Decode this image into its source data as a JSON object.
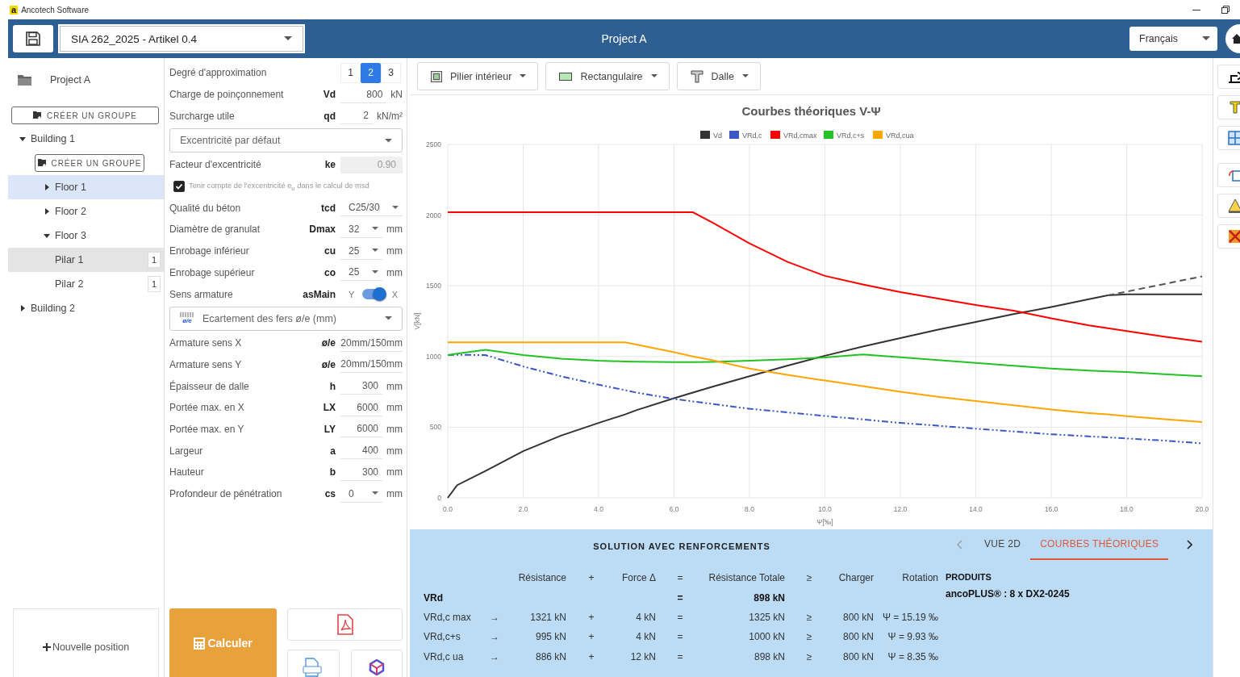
{
  "app": {
    "logo_text": "a",
    "title": "Ancotech Software"
  },
  "header": {
    "standard": "SIA 262_2025 - Artikel 0.4",
    "title": "Project A",
    "language": "Français"
  },
  "sidebar": {
    "project": "Project A",
    "group_button": "CRÉER UN GROUPE",
    "tree": [
      {
        "label": "Building 1",
        "expanded": true,
        "selected": false,
        "active": false,
        "group_button": "CRÉER UN GROUPE",
        "children": [
          {
            "label": "Floor 1",
            "expanded": false,
            "selected": true,
            "active": false
          },
          {
            "label": "Floor 2",
            "expanded": false,
            "selected": false,
            "active": false
          },
          {
            "label": "Floor 3",
            "expanded": true,
            "selected": false,
            "active": false,
            "children": [
              {
                "label": "Pilar 1",
                "badge": "1",
                "selected": false,
                "active": true
              },
              {
                "label": "Pilar 2",
                "badge": "1",
                "selected": false,
                "active": false
              }
            ]
          }
        ]
      },
      {
        "label": "Building 2",
        "expanded": false,
        "selected": false,
        "active": false
      }
    ],
    "new_button": "Nouvelle position"
  },
  "form": {
    "rows": [
      {
        "kind": "segmented",
        "label": "Degré d'approximation",
        "options": [
          {
            "label": "1",
            "selected": false
          },
          {
            "label": "2",
            "selected": true
          },
          {
            "label": "3",
            "selected": false
          }
        ]
      },
      {
        "kind": "input",
        "label": "Charge de poinçonnement",
        "symbol": "Vd",
        "value": "800",
        "unit": "kN",
        "disabled": false
      },
      {
        "kind": "input",
        "label": "Surcharge utile",
        "symbol": "qd",
        "value": "2",
        "unit": "kN/m²",
        "disabled": false
      },
      {
        "kind": "select",
        "value": "Excentricité par défaut"
      },
      {
        "kind": "input",
        "label": "Facteur d'excentricité",
        "symbol": "ke",
        "value": "0.90",
        "disabled": true
      },
      {
        "kind": "checkbox",
        "label": "Tenir compte de l'excentricité e$_{u}$ dans le calcul de msd",
        "checked": true
      },
      {
        "kind": "dropdown",
        "label": "Qualité du béton",
        "symbol": "tcd",
        "value": "C25/30"
      },
      {
        "kind": "dropdown",
        "label": "Diamètre de granulat",
        "symbol": "Dmax",
        "value": "32",
        "unit": "mm"
      },
      {
        "kind": "dropdown",
        "label": "Enrobage inférieur",
        "symbol": "cu",
        "value": "25",
        "unit": "mm"
      },
      {
        "kind": "dropdown",
        "label": "Enrobage supérieur",
        "symbol": "co",
        "value": "25",
        "unit": "mm"
      },
      {
        "kind": "toggle",
        "label": "Sens armature",
        "symbol": "asMain",
        "off_label": "Y",
        "on_label": "X",
        "on": true
      },
      {
        "kind": "select",
        "icon_text": "ø/e",
        "value": "Ecartement des fers ø/e (mm)"
      },
      {
        "kind": "input",
        "label": "Armature sens X",
        "symbol": "ø/e",
        "value": "20mm/150mm",
        "disabled": false
      },
      {
        "kind": "input",
        "label": "Armature sens Y",
        "symbol": "ø/e",
        "value": "20mm/150mm",
        "disabled": false
      },
      {
        "kind": "input",
        "label": "Épaisseur de dalle",
        "symbol": "h",
        "value": "300",
        "unit": "mm",
        "disabled": false
      },
      {
        "kind": "input",
        "label": "Portée max. en X",
        "symbol": "LX",
        "value": "6000",
        "unit": "mm",
        "disabled": false
      },
      {
        "kind": "input",
        "label": "Portée max. en Y",
        "symbol": "LY",
        "value": "6000",
        "unit": "mm",
        "disabled": false
      },
      {
        "kind": "input",
        "label": "Largeur",
        "symbol": "a",
        "value": "400",
        "unit": "mm",
        "disabled": false
      },
      {
        "kind": "input",
        "label": "Hauteur",
        "symbol": "b",
        "value": "300",
        "unit": "mm",
        "disabled": false
      },
      {
        "kind": "dropdown",
        "label": "Profondeur de pénétration",
        "symbol": "cs",
        "value": "0",
        "unit": "mm"
      }
    ],
    "calculate_button": "Calculer"
  },
  "toolbar": [
    {
      "label": "Pilier intérieur",
      "kind": "column"
    },
    {
      "label": "Rectangulaire",
      "kind": "rectangle"
    },
    {
      "label": "Dalle",
      "kind": "slab"
    }
  ],
  "chart": {
    "chart_data": {
      "type": "line",
      "title": "Courbes théoriques V-Ψ",
      "xlabel": "Ψ[‰]",
      "ylabel": "V[kN]",
      "x": [
        0,
        0.25,
        1,
        2,
        3,
        4,
        4.7,
        5,
        6,
        6.5,
        7,
        8,
        9,
        10,
        11,
        12,
        13,
        14,
        15,
        16,
        17,
        17.5,
        18,
        19,
        20
      ],
      "series": [
        {
          "name": "Vd",
          "color": "#333333",
          "line_style": "solid",
          "values": [
            0,
            90,
            190,
            330,
            440,
            530,
            590,
            620,
            705,
            745,
            785,
            860,
            935,
            1005,
            1070,
            1130,
            1190,
            1245,
            1300,
            1350,
            1405,
            1432,
            1440,
            1440,
            1440
          ]
        },
        {
          "name": "VRd,c",
          "color": "#3a57c4",
          "line_style": "dashdot",
          "values": [
            1010,
            1012,
            1010,
            930,
            860,
            800,
            762,
            745,
            700,
            682,
            665,
            630,
            605,
            580,
            555,
            530,
            510,
            490,
            470,
            450,
            435,
            428,
            420,
            405,
            385
          ]
        },
        {
          "name": "VRd,cmax",
          "color": "#ff0000",
          "line_style": "solid",
          "values": [
            2020,
            2020,
            2020,
            2020,
            2020,
            2020,
            2020,
            2020,
            2020,
            2020,
            1950,
            1800,
            1670,
            1570,
            1510,
            1455,
            1410,
            1365,
            1325,
            1270,
            1220,
            1200,
            1180,
            1140,
            1105
          ]
        },
        {
          "name": "VRd,c+s",
          "color": "#22c322",
          "line_style": "solid",
          "values": [
            1010,
            1020,
            1048,
            1010,
            985,
            970,
            965,
            963,
            960,
            960,
            962,
            970,
            980,
            993,
            1015,
            995,
            975,
            955,
            935,
            915,
            900,
            895,
            890,
            875,
            860
          ]
        },
        {
          "name": "VRd,cua",
          "color": "#ffa500",
          "line_style": "solid",
          "values": [
            1100,
            1100,
            1100,
            1100,
            1100,
            1100,
            1100,
            1085,
            1030,
            1000,
            975,
            915,
            870,
            830,
            790,
            750,
            715,
            685,
            655,
            625,
            600,
            590,
            578,
            557,
            537
          ]
        }
      ],
      "legend": true,
      "grid": true,
      "xlim": [
        0,
        20
      ],
      "ylim": [
        0,
        2500
      ],
      "xticks": [
        {
          "value": 0,
          "label": "0.0"
        },
        {
          "value": 2,
          "label": "2.0"
        },
        {
          "value": 4,
          "label": "4.0"
        },
        {
          "value": 6,
          "label": "6.0"
        },
        {
          "value": 8,
          "label": "8.0"
        },
        {
          "value": 10,
          "label": "10.0"
        },
        {
          "value": 12,
          "label": "12.0"
        },
        {
          "value": 14,
          "label": "14.0"
        },
        {
          "value": 16,
          "label": "16.0"
        },
        {
          "value": 18,
          "label": "18.0"
        },
        {
          "value": 20,
          "label": "20.0"
        }
      ],
      "yticks": [
        0,
        500,
        1000,
        1500,
        2000,
        2500
      ]
    }
  },
  "results": {
    "title": "SOLUTION AVEC RENFORCEMENTS",
    "tabs": [
      {
        "label": "VUE 2D",
        "selected": false
      },
      {
        "label": "COURBES THÉORIQUES",
        "selected": true
      }
    ],
    "columns": [
      "Résistance",
      "+",
      "Force Δ",
      "=",
      "Résistance Totale",
      "≥",
      "Charger",
      "Rotation"
    ],
    "rows": [
      {
        "label": "VRd",
        "eq": "=",
        "total": "898 kN",
        "bold": true
      },
      {
        "label": "VRd,c max",
        "arrow": "→",
        "resistance": "1321 kN",
        "plus": "+",
        "force": "4 kN",
        "eq": "=",
        "total": "1325 kN",
        "ge": "≥",
        "load": "800 kN",
        "rotation": "Ψ = 15.19 ‰",
        "bold": false
      },
      {
        "label": "VRd,c+s",
        "arrow": "→",
        "resistance": "995 kN",
        "plus": "+",
        "force": "4 kN",
        "eq": "=",
        "total": "1000 kN",
        "ge": "≥",
        "load": "800 kN",
        "rotation": "Ψ = 9.93 ‰",
        "bold": false
      },
      {
        "label": "VRd,c ua",
        "arrow": "→",
        "resistance": "886 kN",
        "plus": "+",
        "force": "12 kN",
        "eq": "=",
        "total": "898 kN",
        "ge": "≥",
        "load": "800 kN",
        "rotation": "Ψ = 8.35 ‰",
        "bold": false
      }
    ],
    "products_title": "PRODUITS",
    "products": "ancoPLUS® : 8 x DX2-0245"
  }
}
